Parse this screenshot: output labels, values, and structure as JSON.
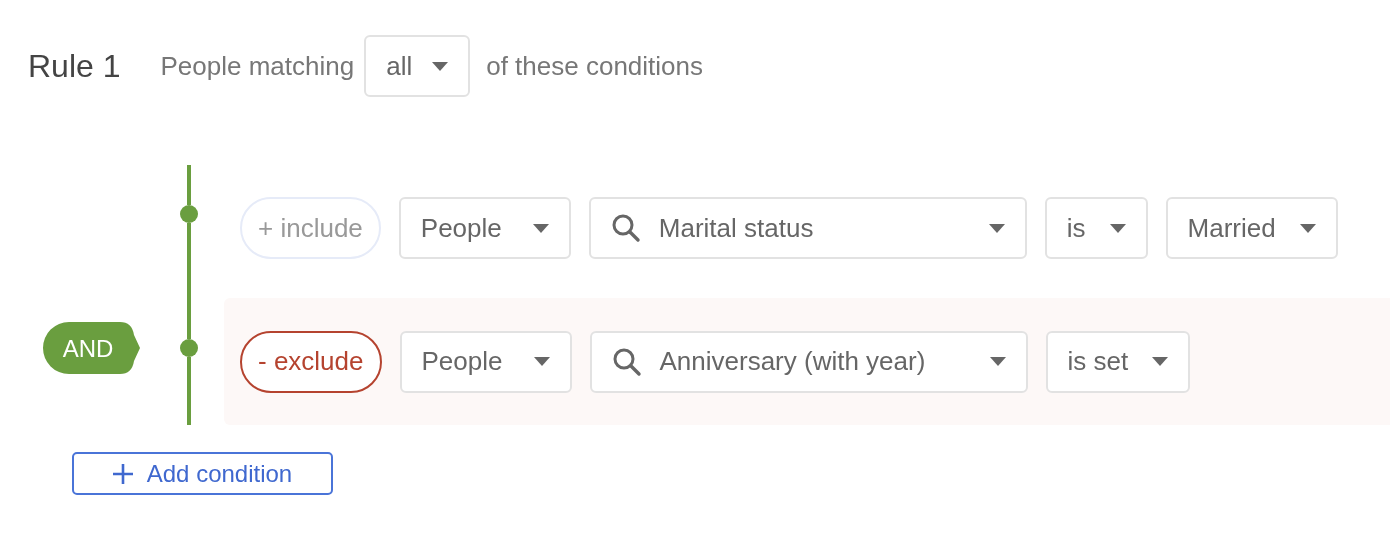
{
  "rule": {
    "title": "Rule 1",
    "prefix": "People matching",
    "match": {
      "value": "all"
    },
    "suffix": "of these conditions"
  },
  "conditions": [
    {
      "kind": "include",
      "label": "+ include",
      "fields": [
        {
          "kind": "source",
          "value": "People"
        },
        {
          "kind": "search",
          "value": "Marital status"
        },
        {
          "kind": "operator",
          "value": "is"
        },
        {
          "kind": "value",
          "value": "Married"
        }
      ]
    },
    {
      "kind": "exclude",
      "label": "- exclude",
      "connector": "AND",
      "fields": [
        {
          "kind": "source",
          "value": "People"
        },
        {
          "kind": "search",
          "value": "Anniversary (with year)"
        },
        {
          "kind": "operator",
          "value": "is set"
        }
      ]
    }
  ],
  "add_button": {
    "label": "Add condition"
  }
}
